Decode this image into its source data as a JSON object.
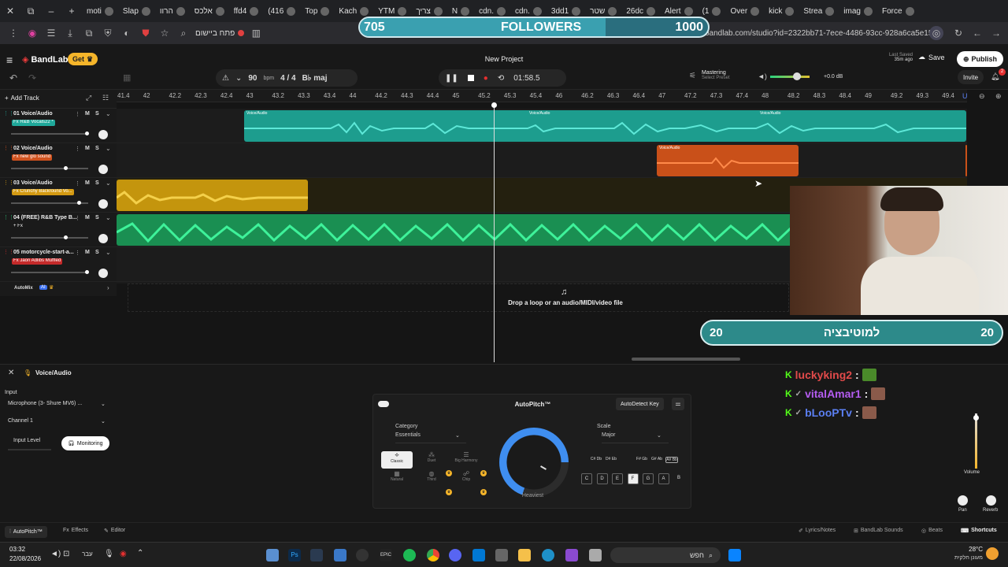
{
  "browser": {
    "tabs": [
      "moti",
      "Slap",
      "הרוו",
      "אלכס",
      "ffd4",
      "(416",
      "Top",
      "Kach",
      "YTM",
      "צריך",
      "N",
      "cdn.",
      "cdn.",
      "3dd1",
      "שטר",
      "26dc",
      "Alert",
      "(1",
      "Over",
      "kick",
      "Strea",
      "imag",
      "Force"
    ],
    "url": "bandlab.com/studio?id=2322bb71-7ece-4486-93cc-928a6ca5e155",
    "bookmark": "פתח ביישום"
  },
  "followers": {
    "current": "705",
    "label": "FOLLOWERS",
    "goal": "1000",
    "progress": 0.705
  },
  "app": {
    "logo": "BandLab",
    "get_label": "Get",
    "project_title": "New Project",
    "bpm": "90",
    "bpm_unit": "bpm",
    "time_sig": "4 / 4",
    "key": "B♭ maj",
    "time": "01:58.5",
    "mastering": "Mastering",
    "mastering_sub": "Select Preset",
    "db": "+0.0 dB",
    "last_saved": "Last Saved",
    "last_saved_ago": "35m ago",
    "save": "Save",
    "publish": "Publish",
    "invite": "Invite",
    "notif_count": "2",
    "add_track": "Add Track"
  },
  "ruler": [
    "41.4",
    "42",
    "42.2",
    "42.3",
    "42.4",
    "43",
    "43.2",
    "43.3",
    "43.4",
    "44",
    "44.2",
    "44.3",
    "44.4",
    "45",
    "45.2",
    "45.3",
    "45.4",
    "46",
    "46.2",
    "46.3",
    "46.4",
    "47",
    "47.2",
    "47.3",
    "47.4",
    "48",
    "48.2",
    "48.3",
    "48.4",
    "49",
    "49.2",
    "49.3",
    "49.4"
  ],
  "tracks": [
    {
      "name": "01  Voice/Audio",
      "fx": "Fx R&B Vocals22 *",
      "fx_color": "#1fa89a"
    },
    {
      "name": "02  Voice/Audio",
      "fx": "Fx new glo sound",
      "fx_color": "#d0521e"
    },
    {
      "name": "03  Voice/Audio",
      "fx": "Fx Crunchy Backround Vo...",
      "fx_color": "#d49a12"
    },
    {
      "name": "04  (FREE) R&B Type B...",
      "fx": "+ Fx",
      "fx_color": "transparent"
    },
    {
      "name": "05  motorcycle-start-a...",
      "fx": "Fx Jaon Adlibs Muffled",
      "fx_color": "#c42a2a"
    }
  ],
  "clip_label": "Voice/Audio",
  "automix": "AutoMix",
  "automix_badge": "AI",
  "drop_hint": "Drop a loop or an audio/MIDI/video file",
  "motivation": {
    "left": "20",
    "label": "למוטיבציה",
    "right": "20"
  },
  "panel": {
    "title": "Voice/Audio",
    "input_label": "Input",
    "input_device": "Microphone (3- Shure MV6) ...",
    "channel": "Channel 1",
    "input_level": "Input Level",
    "monitoring": "Monitoring",
    "autopitch": "AutoPitch™",
    "autodetect": "AutoDetect Key",
    "category_label": "Category",
    "category": "Essentials",
    "presets": [
      "Classic",
      "Duet",
      "Big Harmony",
      "Natural",
      "Third",
      "Chip"
    ],
    "dial_label": "Heaviest",
    "scale_label": "Scale",
    "scale": "Major",
    "sharp_keys": [
      "C# Db",
      "D# Eb",
      "F# Gb",
      "G# Ab",
      "A# Bb"
    ],
    "keys": [
      "C",
      "D",
      "E",
      "F",
      "G",
      "A",
      "B"
    ],
    "volume": "Volume",
    "pan": "Pan",
    "reverb": "Reverb"
  },
  "chat": [
    {
      "user": "luckyking2",
      "color": "#e24a4a"
    },
    {
      "user": "vitalAmar1",
      "color": "#b45cf0"
    },
    {
      "user": "bLooPTv",
      "color": "#5b7ff2"
    }
  ],
  "bottom_tabs": [
    "AutoPitch™",
    "Effects",
    "Editor"
  ],
  "bottom_right": [
    "Lyrics/Notes",
    "BandLab Sounds",
    "Beats",
    "Shortcuts"
  ],
  "taskbar": {
    "time": "03:32",
    "date": "22/08/2026",
    "lang": "עבר",
    "search": "חפש",
    "temp": "28°C",
    "weather": "מעונן חלקית"
  }
}
